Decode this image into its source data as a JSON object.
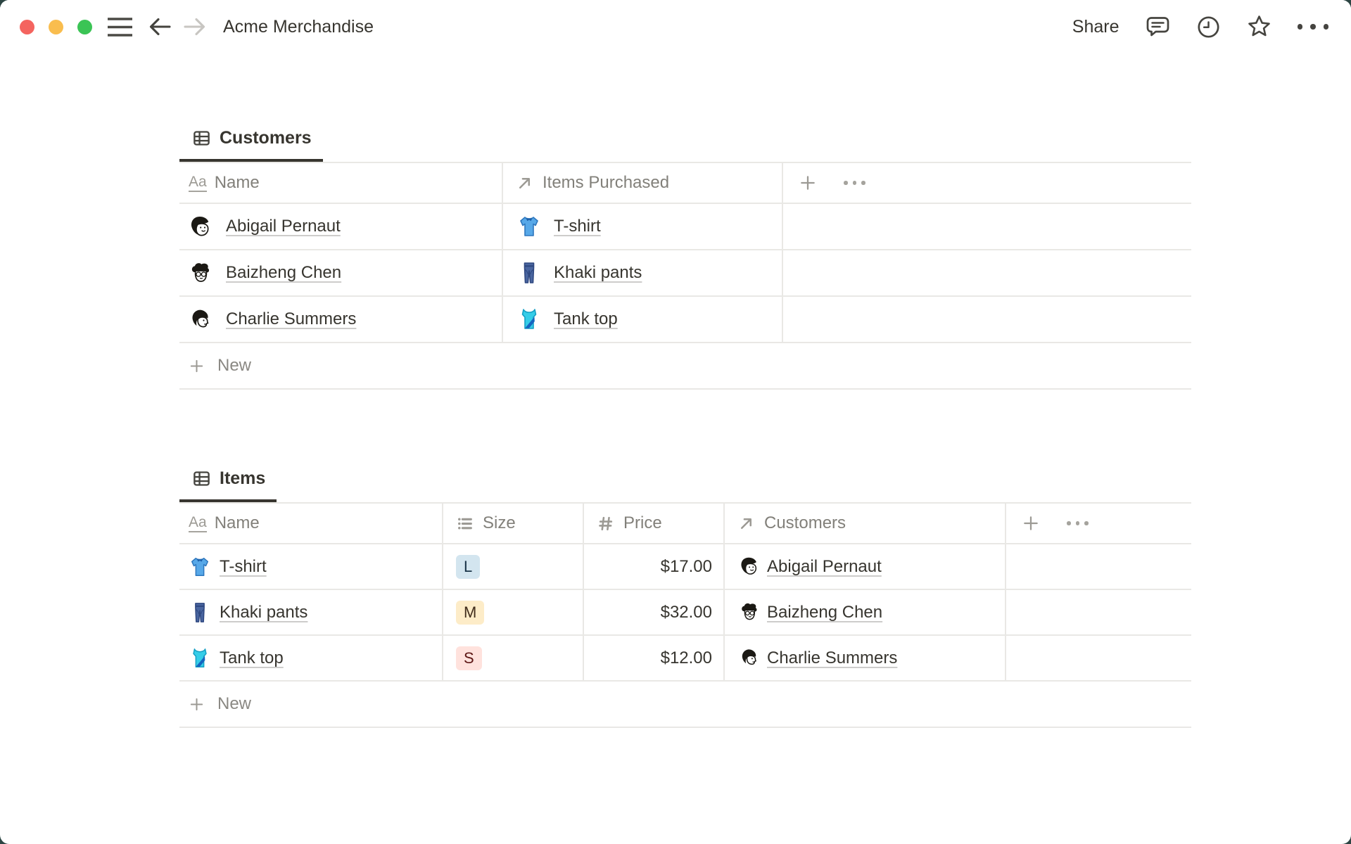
{
  "topbar": {
    "title": "Acme Merchandise",
    "share_label": "Share"
  },
  "customers_table": {
    "tab_label": "Customers",
    "columns": {
      "name": "Name",
      "items_purchased": "Items Purchased"
    },
    "rows": [
      {
        "name": "Abigail Pernaut",
        "item": "T-shirt"
      },
      {
        "name": "Baizheng Chen",
        "item": "Khaki pants"
      },
      {
        "name": "Charlie Summers",
        "item": "Tank top"
      }
    ],
    "new_label": "New"
  },
  "items_table": {
    "tab_label": "Items",
    "columns": {
      "name": "Name",
      "size": "Size",
      "price": "Price",
      "customers": "Customers"
    },
    "rows": [
      {
        "name": "T-shirt",
        "size": "L",
        "size_color": "blue",
        "price": "$17.00",
        "customer": "Abigail Pernaut"
      },
      {
        "name": "Khaki pants",
        "size": "M",
        "size_color": "yellow",
        "price": "$32.00",
        "customer": "Baizheng Chen"
      },
      {
        "name": "Tank top",
        "size": "S",
        "size_color": "red",
        "price": "$12.00",
        "customer": "Charlie Summers"
      }
    ],
    "new_label": "New"
  },
  "colors": {
    "text_primary": "#37352F",
    "text_secondary": "#82807A",
    "border": "#E9E8E5",
    "size_blue_bg": "#D3E5EF",
    "size_blue_text": "#183347",
    "size_yellow_bg": "#FDECC8",
    "size_yellow_text": "#402C1B",
    "size_red_bg": "#FFE2DD",
    "size_red_text": "#5D1715"
  }
}
